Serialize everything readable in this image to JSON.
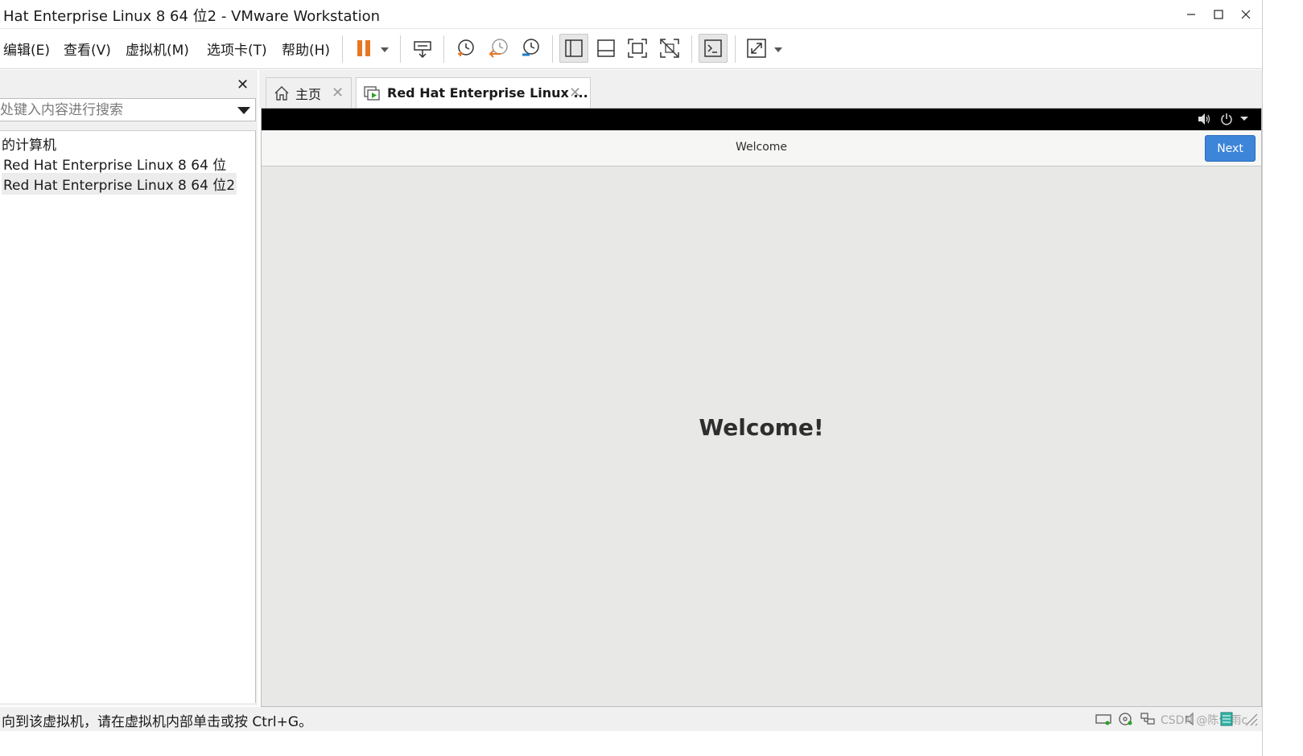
{
  "window": {
    "title": "Hat Enterprise Linux 8 64 位2 - VMware Workstation"
  },
  "menu": {
    "items": [
      "编辑(E)",
      "查看(V)",
      "虚拟机(M)",
      "选项卡(T)",
      "帮助(H)"
    ]
  },
  "toolbar": {
    "icons": [
      "pause-icon",
      "send-keys-icon",
      "snapshot-take-icon",
      "snapshot-revert-icon",
      "snapshot-manager-icon",
      "library-view-icon",
      "thumbnail-bar-icon",
      "fullscreen-icon",
      "unity-icon",
      "console-icon",
      "stretch-icon"
    ],
    "accent": "#e87722"
  },
  "sidebar": {
    "search_placeholder": "处键入内容进行搜索",
    "tree": [
      "的计算机",
      "Red Hat Enterprise Linux 8 64 位",
      "Red Hat Enterprise Linux 8 64 位2"
    ]
  },
  "tabs": [
    {
      "label": "主页"
    },
    {
      "label": "Red Hat Enterprise Linux ..."
    }
  ],
  "vm": {
    "header_title": "Welcome",
    "next_label": "Next",
    "welcome_text": "Welcome!",
    "next_color": "#3d85d8"
  },
  "status": {
    "message": "向到该虚拟机，请在虚拟机内部单击或按 Ctrl+G。",
    "watermark": "CSDN @陈佳雨c"
  }
}
